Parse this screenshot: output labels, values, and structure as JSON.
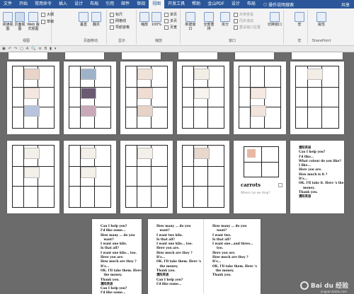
{
  "tabs": [
    "文件",
    "开始",
    "常用命令",
    "插入",
    "设计",
    "布局",
    "引用",
    "邮件",
    "审阅",
    "视图",
    "开发工具",
    "帮助",
    "金山PDF",
    "设计",
    "布局"
  ],
  "active_tab_index": 9,
  "tell_me": "操作说明搜索",
  "share": "共享",
  "ribbon": {
    "views": {
      "label": "视图",
      "buttons": [
        "阅读视图",
        "页面视图",
        "Web 版式视图"
      ],
      "small": [
        "大纲",
        "草稿"
      ]
    },
    "page_move": {
      "label": "页面移动",
      "buttons": [
        "垂直",
        "翻页"
      ]
    },
    "show": {
      "label": "显示",
      "checks": [
        "标尺",
        "网格线",
        "导航窗格"
      ]
    },
    "zoom": {
      "label": "缩放",
      "zoom_button": "缩放",
      "percent": "100%",
      "small": [
        "单页",
        "多页",
        "页宽"
      ]
    },
    "window": {
      "label": "窗口",
      "buttons": [
        "新建窗口",
        "全部重排",
        "拆分"
      ],
      "small": [
        "并排查看",
        "同步滚动",
        "重设窗口位置"
      ],
      "switch": "切换窗口"
    },
    "macro": {
      "label": "宏",
      "button": "宏"
    },
    "sharepoint": {
      "label": "SharePoint",
      "button": "属性"
    }
  },
  "text_pages": {
    "p11": "濮阳英语\nCan I help you?\nI'd like...\nWhat colour do you like?\nI like...\nHere you are.\nHow much is it ?\nIt's...\nOK. I'll take it. Here 's the\n    money.\nThank you.\n濮阳英语",
    "p12": "Can I help you?\nI'd like some...\nHow many ... do you\n   want?\nI want one kilo.\nIs that all?\nI want one kilo... too.\nHere you are.\nHow much are they ?\nIt's...\nOK. I'll take them. Here 's\n   the money.\nThank you.\n濮阳英语\nCan I help you?\nI'd like some...",
    "p13": "How many ... do you\n   want?\nI want two kilo.\nIs that all?\nI want one kilo... too.\nHere you are.\nHow much are they ?\nIt's...\nOK. I'll take them. Here 's\n   the money.\nThank you.\n濮阳英语\nCan I help you?\nI'd like some...",
    "p14": "How many ... do you\n    want?\nI want two.\nIs that all?\nI want one...and three...\n    too.\nHere you are.\nHow much are they ?\nIt's...\nOK. I'll take them. Here 's\n   the money.\nThank you."
  },
  "carrots": {
    "title": "carrots",
    "subtitle": "Where can we shop?"
  },
  "watermark": {
    "text": "Bai du 经验",
    "sub": "jingyan.baidu.com"
  }
}
